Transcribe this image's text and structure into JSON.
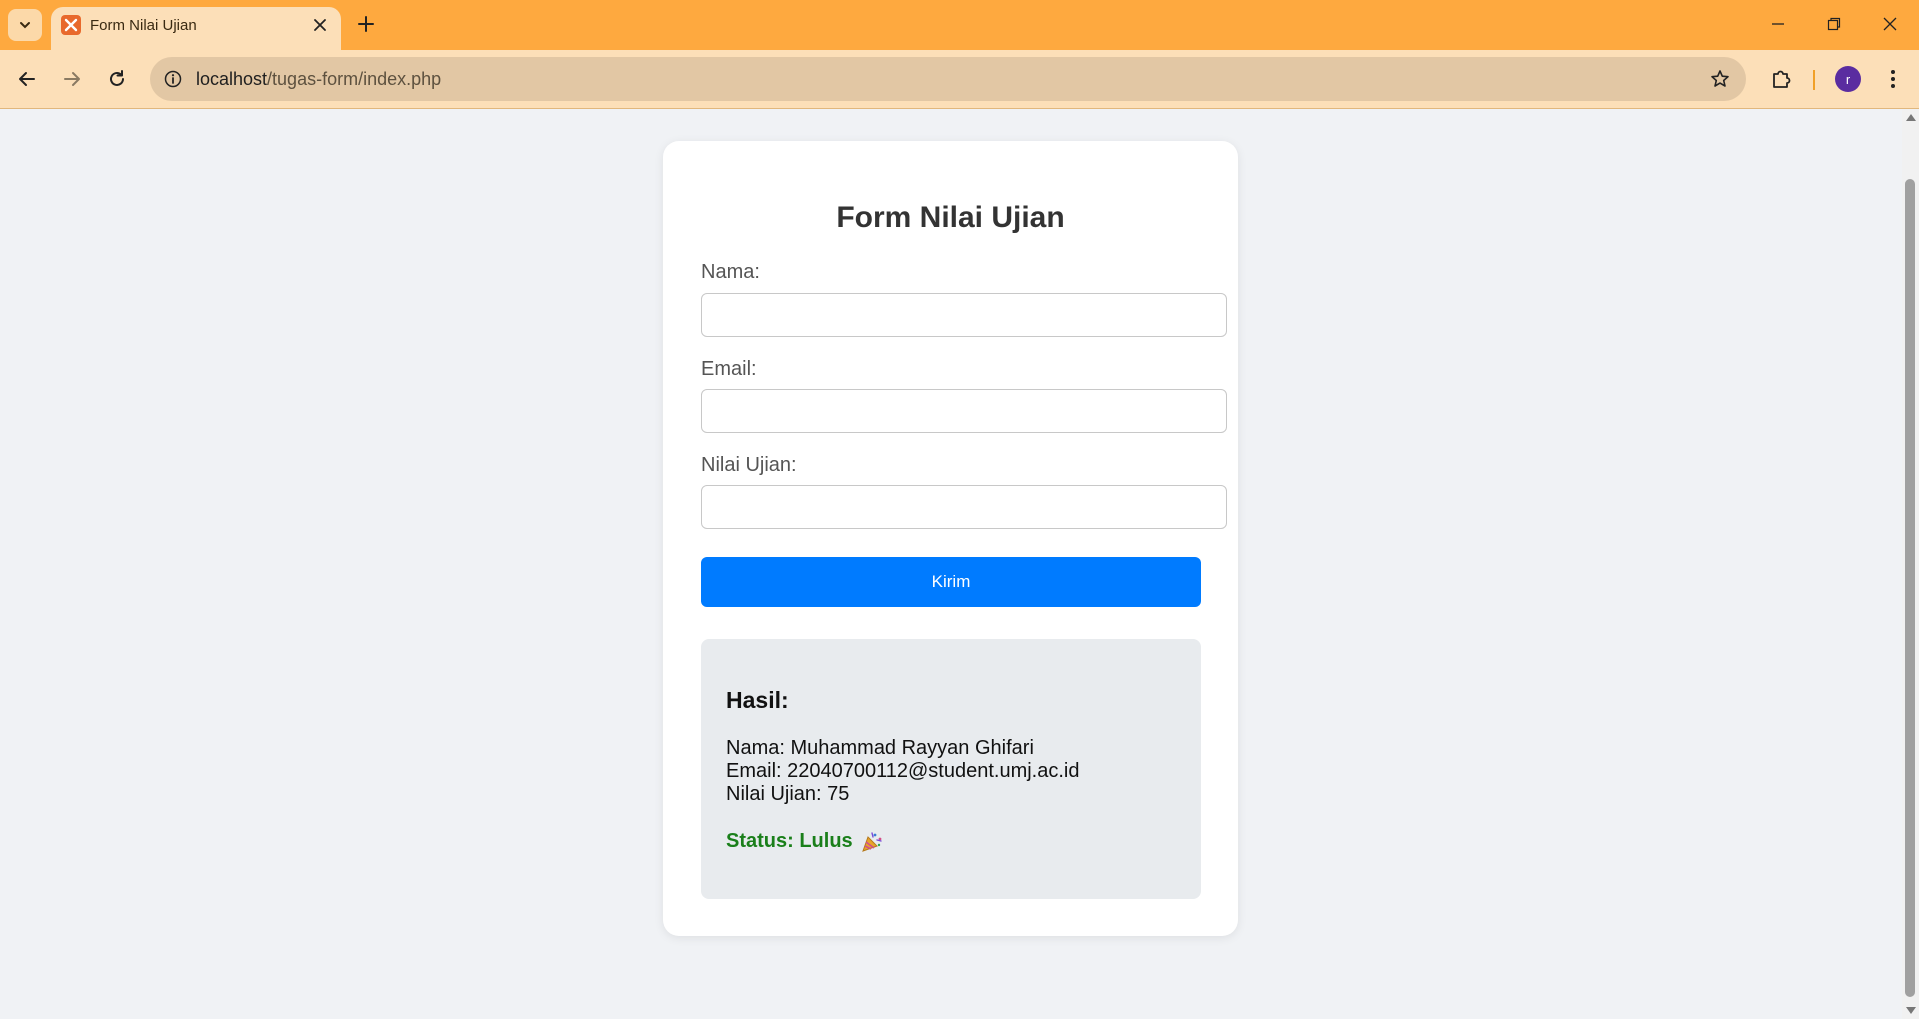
{
  "browser": {
    "tab_title": "Form Nilai Ujian",
    "url_host": "localhost",
    "url_path": "/tugas-form/index.php",
    "avatar_letter": "r",
    "accent_color": "#fea93f"
  },
  "form": {
    "title": "Form Nilai Ujian",
    "nama_label": "Nama:",
    "nama_value": "",
    "email_label": "Email:",
    "email_value": "",
    "nilai_label": "Nilai Ujian:",
    "nilai_value": "",
    "submit_label": "Kirim",
    "submit_color": "#007bff"
  },
  "result": {
    "heading": "Hasil:",
    "nama_line": "Nama: Muhammad Rayyan Ghifari",
    "email_line": "Email: 22040700112@student.umj.ac.id",
    "nilai_line": "Nilai Ujian: 75",
    "status": "Status: Lulus",
    "status_color": "#1a7f1a",
    "status_icon": "party-popper-icon"
  }
}
